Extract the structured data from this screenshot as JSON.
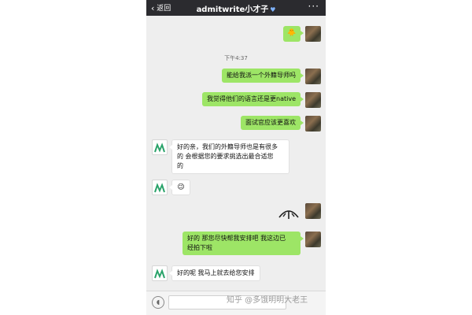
{
  "header": {
    "back_label": "返回",
    "title": "admitwrite小才子",
    "more_label": "···"
  },
  "messages": {
    "m1_sticker": "🐥",
    "timestamp": "下午4:37",
    "m2": "能给我派一个外籍导师吗",
    "m3": "我觉得他们的语言还是更native",
    "m4": "面试官应该更喜欢",
    "m5_line1": "好的亲，我们的外籍导师也是有很多",
    "m5_line2": "的 会根据您的要求挑选出最合适您",
    "m5_line3": "的",
    "m6_emoji": "😉",
    "m8_line1": "好的 那您尽快帮我安排吧 我这边已",
    "m8_line2": "经拍下啦",
    "m9": "好的呢 我马上就去给您安排"
  },
  "inputbar": {
    "voice_icon": "voice-icon",
    "text_value": ""
  },
  "watermark": "知乎 @多饿明明大老王",
  "colors": {
    "my_bubble": "#9de566",
    "agent_bubble": "#ffffff",
    "chat_bg": "#eeeeee",
    "topbar": "#2b2b2f",
    "agent_logo": "#2aa36a"
  }
}
